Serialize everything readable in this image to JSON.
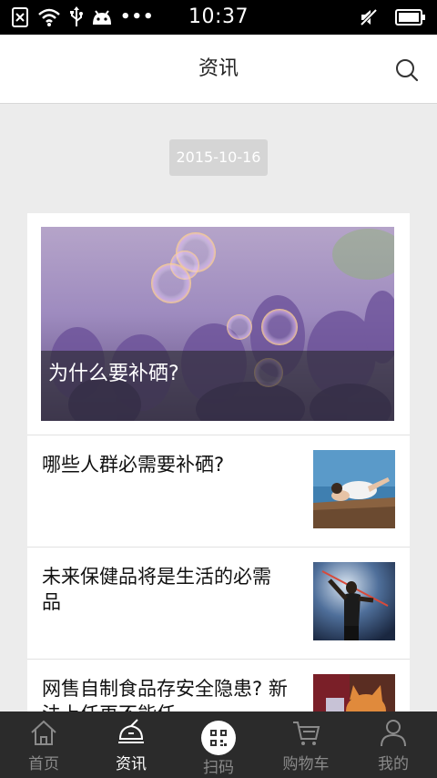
{
  "status_bar": {
    "time": "10:37",
    "more": "•••",
    "icons": [
      "no-sim-icon",
      "wifi-icon",
      "usb-icon",
      "android-icon",
      "mute-icon",
      "battery-icon"
    ]
  },
  "header": {
    "title": "资讯",
    "search_icon": "search-icon"
  },
  "date_label": "2015-10-16",
  "featured": {
    "title": "为什么要补硒?"
  },
  "articles": [
    {
      "title": "哪些人群必需要补硒?"
    },
    {
      "title": "未来保健品将是生活的必需品"
    },
    {
      "title": "网售自制食品存安全隐患? 新法上任再不能任"
    }
  ],
  "tabbar": {
    "items": [
      {
        "label": "首页",
        "icon": "home-icon"
      },
      {
        "label": "资讯",
        "icon": "news-icon"
      },
      {
        "label": "扫码",
        "icon": "qr-scan-icon"
      },
      {
        "label": "购物车",
        "icon": "cart-icon"
      },
      {
        "label": "我的",
        "icon": "user-icon"
      }
    ],
    "active_index": 1
  },
  "colors": {
    "tabbar_bg": "#2b2b2b",
    "header_bg": "#ffffff",
    "page_bg": "#ececec"
  }
}
